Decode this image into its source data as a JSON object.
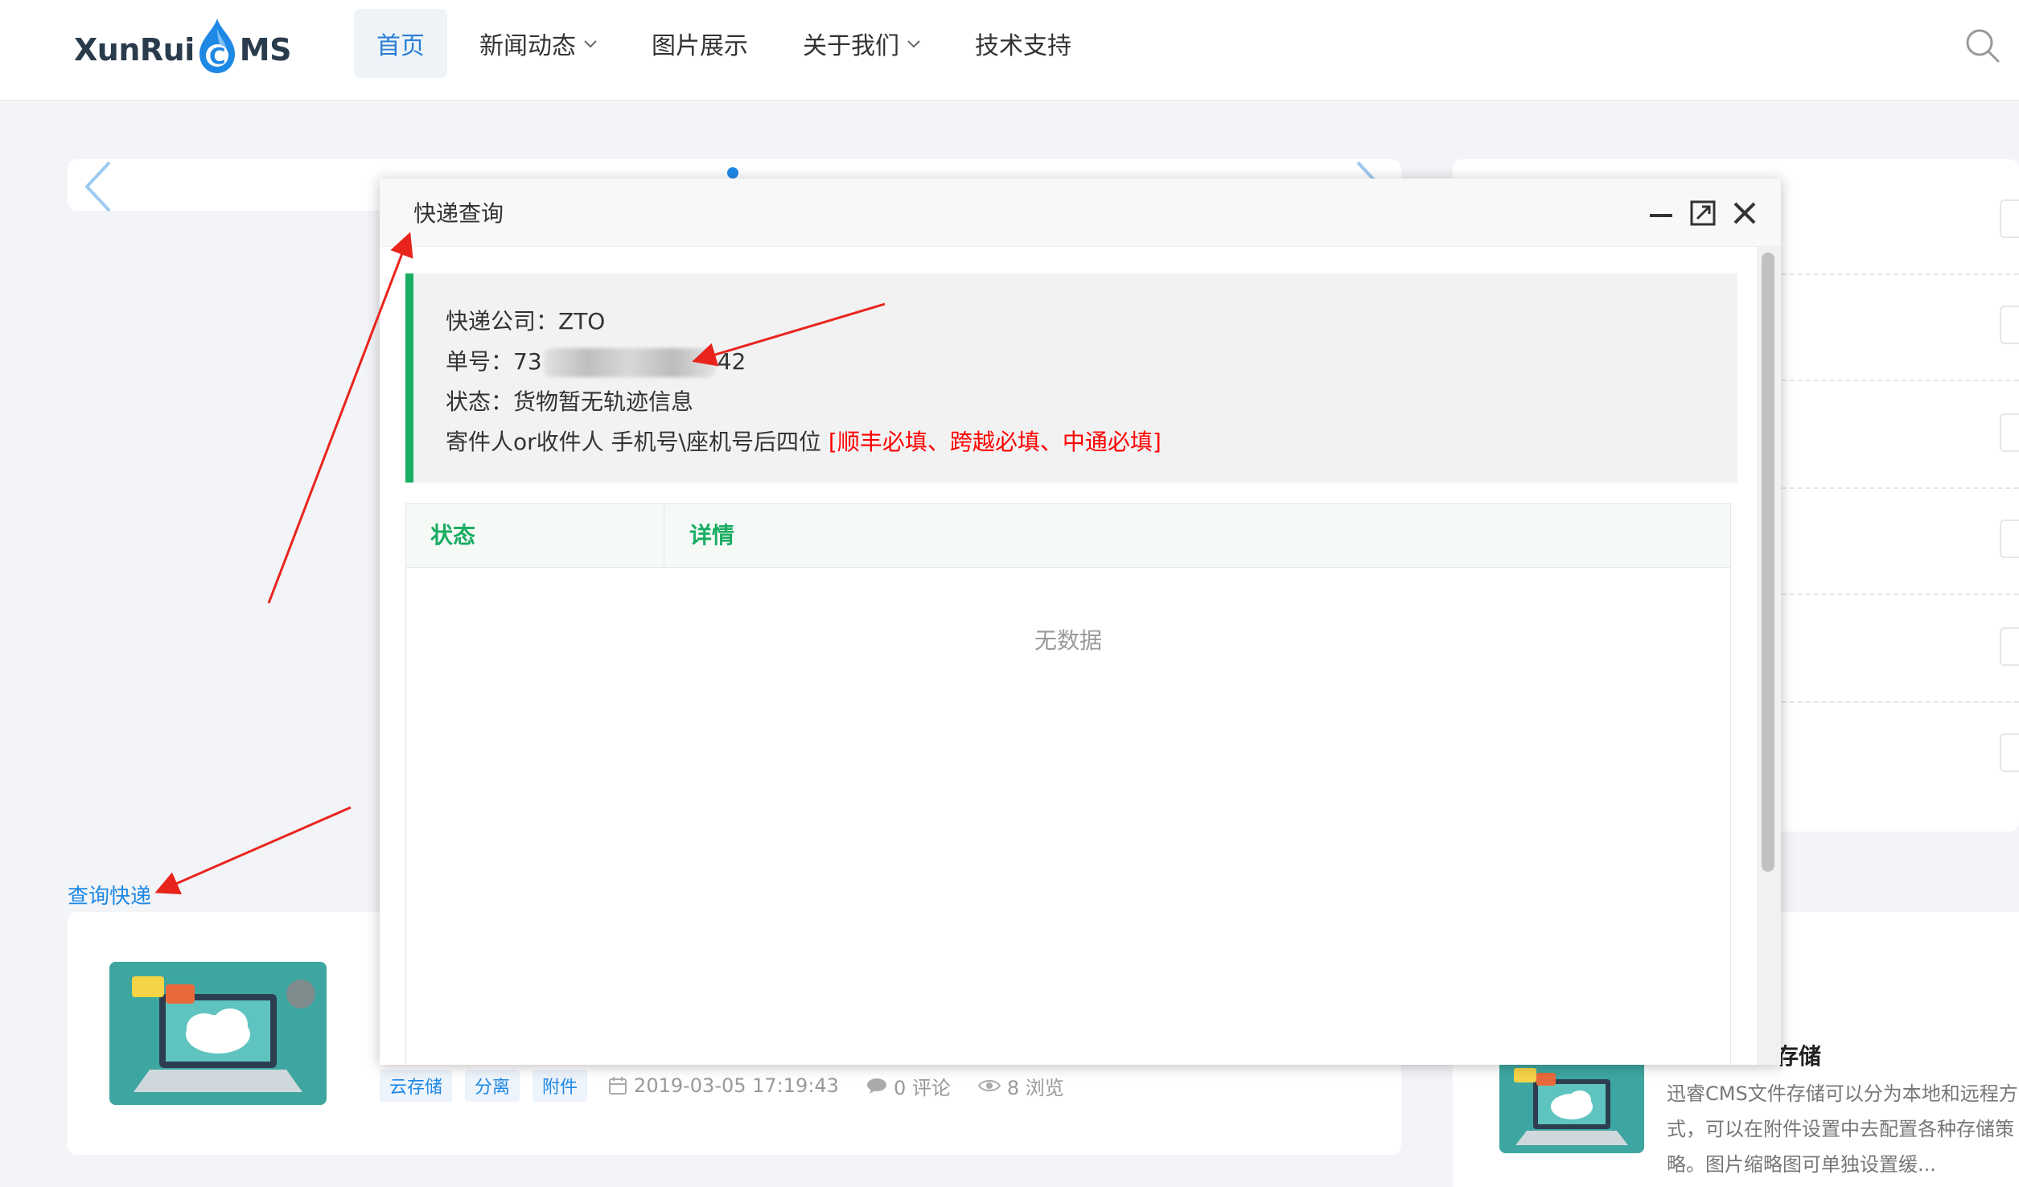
{
  "header": {
    "logo_left": "XunRui",
    "logo_c": "C",
    "logo_right": "MS",
    "nav": [
      {
        "label": "首页",
        "active": true,
        "dropdown": false
      },
      {
        "label": "新闻动态",
        "active": false,
        "dropdown": true
      },
      {
        "label": "图片展示",
        "active": false,
        "dropdown": false
      },
      {
        "label": "关于我们",
        "active": false,
        "dropdown": true
      },
      {
        "label": "技术支持",
        "active": false,
        "dropdown": false
      }
    ],
    "search_icon": "search-icon"
  },
  "page": {
    "query_link": "查询快递",
    "card": {
      "tags": [
        "云存储",
        "分离",
        "附件"
      ],
      "date": "2019-03-05 17:19:43",
      "comments": "0 评论",
      "views": "8 浏览"
    },
    "side_card": {
      "title_fragment": "存储",
      "desc_lines": [
        "迅睿CMS文件存储可以分为本地和远程方",
        "式，可以在附件设置中去配置各种存储策",
        "略。图片缩略图可单独设置缓..."
      ]
    }
  },
  "dialog": {
    "title": "快递查询",
    "controls": [
      "minimize-icon",
      "maximize-icon",
      "close-icon"
    ],
    "info": {
      "company_label": "快递公司：",
      "company_value": "ZTO",
      "number_label": "单号：",
      "number_prefix": "73",
      "number_suffix": "42",
      "status_label": "状态：",
      "status_value": "货物暂无轨迹信息",
      "phone_hint": "寄件人or收件人 手机号\\座机号后四位 ",
      "phone_required": "[顺丰必填、跨越必填、中通必填]"
    },
    "table": {
      "columns": [
        "状态",
        "详情"
      ],
      "empty_text": "无数据"
    }
  },
  "colors": {
    "accent_blue": "#1e88e5",
    "accent_green": "#1aad63",
    "annotation_red": "#e8241d",
    "required_red": "#ff0000"
  }
}
